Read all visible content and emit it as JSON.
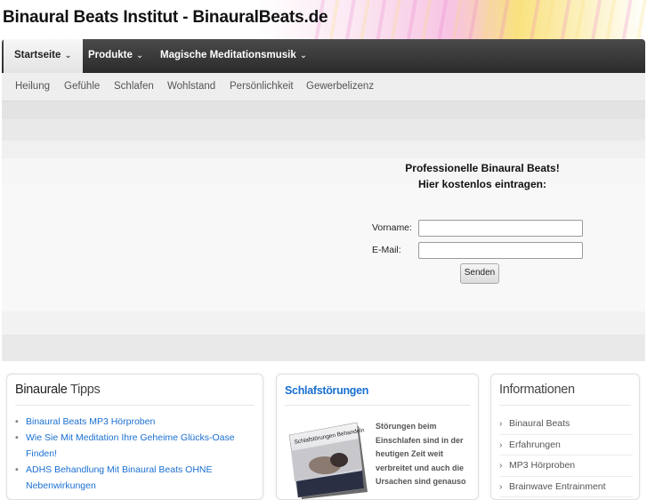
{
  "site": {
    "title": "Binaural Beats Institut - BinauralBeats.de"
  },
  "nav": {
    "items": [
      {
        "label": "Startseite",
        "chevron": "⌄",
        "active": true
      },
      {
        "label": "Produkte",
        "chevron": "⌄",
        "active": false
      },
      {
        "label": "Magische Meditationsmusik",
        "chevron": "⌄",
        "active": false
      }
    ]
  },
  "subnav": {
    "items": [
      "Heilung",
      "Gefühle",
      "Schlafen",
      "Wohlstand",
      "Persönlichkeit",
      "Gewerbelizenz"
    ]
  },
  "signup": {
    "heading_line1": "Professionelle Binaural Beats!",
    "heading_line2": "Hier kostenlos eintragen:",
    "vorname_label": "Vorname:",
    "vorname_value": "",
    "email_label": "E-Mail:",
    "email_value": "",
    "submit_label": "Senden"
  },
  "tipps": {
    "title_part1": "Binaurale",
    "title_part2": " Tipps",
    "items": [
      "Binaural Beats MP3 Hörproben",
      "Wie Sie Mit Meditation Ihre Geheime Glücks-Oase Finden!",
      "ADHS Behandlung Mit Binaural Beats OHNE Nebenwirkungen"
    ]
  },
  "schlaf": {
    "title": "Schlafstörungen",
    "book_cover_text": "Schlafstörungen Behandeln",
    "description": "Störungen beim Einschlafen sind in der heutigen Zeit weit verbreitet und auch die Ursachen sind genauso"
  },
  "info": {
    "title": "Informationen",
    "items": [
      "Binaural Beats",
      "Erfahrungen",
      "MP3 Hörproben",
      "Brainwave Entrainment"
    ]
  },
  "colors": {
    "link": "#1a6fd1",
    "nav_bg": "#333333"
  }
}
